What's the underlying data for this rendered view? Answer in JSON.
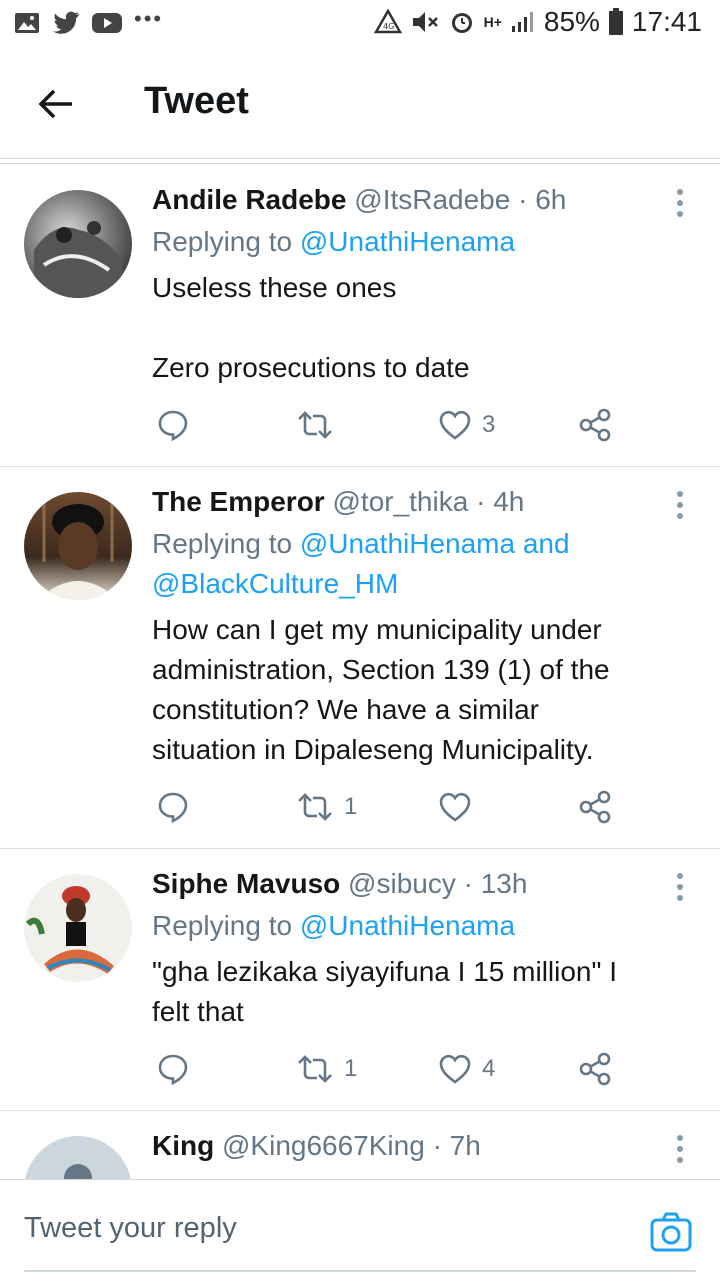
{
  "status_bar": {
    "left_icons": [
      "gallery-icon",
      "twitter-icon",
      "youtube-icon",
      "overflow-dots-icon"
    ],
    "right_icons": [
      "recycle-icon",
      "mute-icon",
      "alarm-icon",
      "hplus-icon",
      "signal-icon",
      "battery-icon"
    ],
    "network": "H+",
    "battery": "85%",
    "time": "17:41"
  },
  "header": {
    "title": "Tweet"
  },
  "tweets": [
    {
      "name": "Andile Radebe",
      "handle": "@ItsRadebe",
      "time": "· 6h",
      "replying_prefix": "Replying to",
      "mentions": "@UnathiHenama",
      "body": [
        "Useless these ones",
        "",
        "Zero prosecutions to date"
      ],
      "retweets": "",
      "likes": "3"
    },
    {
      "name": "The Emperor",
      "handle": "@tor_thika",
      "time": "· 4h",
      "replying_prefix": "Replying to",
      "mentions": "@UnathiHenama and",
      "mentions2": "@BlackCulture_HM",
      "body": [
        "How can I get my municipality under",
        "administration, Section 139 (1) of the",
        "constitution? We have a similar",
        "situation in Dipaleseng Municipality."
      ],
      "retweets": "1",
      "likes": ""
    },
    {
      "name": "Siphe Mavuso",
      "handle": "@sibucy",
      "time": "· 13h",
      "replying_prefix": "Replying to",
      "mentions": "@UnathiHenama",
      "body": [
        "\"gha lezikaka siyayifuna I 15 million\" I",
        "felt that"
      ],
      "retweets": "1",
      "likes": "4"
    },
    {
      "name": "King",
      "handle": "@King6667King",
      "time": "· 7h"
    }
  ],
  "composer": {
    "placeholder": "Tweet your reply"
  },
  "colors": {
    "accent": "#1da1f2",
    "muted": "#657786",
    "text": "#14171a"
  }
}
